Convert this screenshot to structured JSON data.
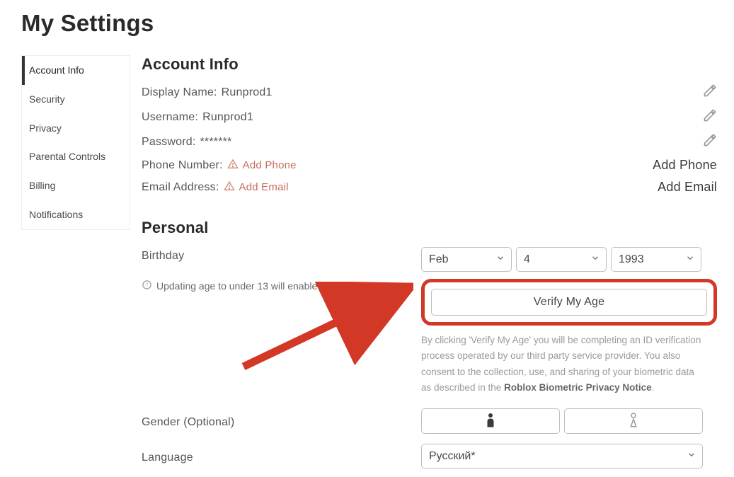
{
  "page_title": "My Settings",
  "sidebar": {
    "items": [
      {
        "label": "Account Info",
        "active": true
      },
      {
        "label": "Security"
      },
      {
        "label": "Privacy"
      },
      {
        "label": "Parental Controls"
      },
      {
        "label": "Billing"
      },
      {
        "label": "Notifications"
      }
    ]
  },
  "account_info": {
    "heading": "Account Info",
    "display_name_label": "Display Name:",
    "display_name_value": "Runprod1",
    "username_label": "Username:",
    "username_value": "Runprod1",
    "password_label": "Password:",
    "password_value": "*******",
    "phone_label": "Phone Number:",
    "phone_add_link": "Add Phone",
    "phone_right_action": "Add Phone",
    "email_label": "Email Address:",
    "email_add_link": "Add Email",
    "email_right_action": "Add Email"
  },
  "personal": {
    "heading": "Personal",
    "birthday_label": "Birthday",
    "birthday_month": "Feb",
    "birthday_day": "4",
    "birthday_year": "1993",
    "age_notice": "Updating age to under 13 will enable Privacy Mode.",
    "verify_button": "Verify My Age",
    "verify_disclaimer_part1": "By clicking 'Verify My Age' you will be completing an ID verification process operated by our third party service provider. You also consent to the collection, use, and sharing of your biometric data as described in the ",
    "verify_disclaimer_bold": "Roblox Biometric Privacy Notice",
    "verify_disclaimer_part2": ".",
    "gender_label": "Gender (Optional)",
    "language_label": "Language",
    "language_value": "Русский*"
  }
}
